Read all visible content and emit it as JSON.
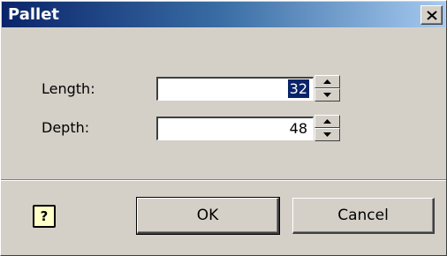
{
  "window": {
    "title": "Pallet",
    "close_glyph": "✕"
  },
  "fields": {
    "length": {
      "label": "Length:",
      "value": "32"
    },
    "depth": {
      "label": "Depth:",
      "value": "48"
    }
  },
  "help": {
    "glyph": "?",
    "icon": "help-icon"
  },
  "buttons": {
    "ok": "OK",
    "cancel": "Cancel"
  },
  "colors": {
    "titlebar_start": "#0a246a",
    "titlebar_end": "#a6caf0",
    "dialog_bg": "#d4d0c8",
    "selection": "#0a246a"
  }
}
